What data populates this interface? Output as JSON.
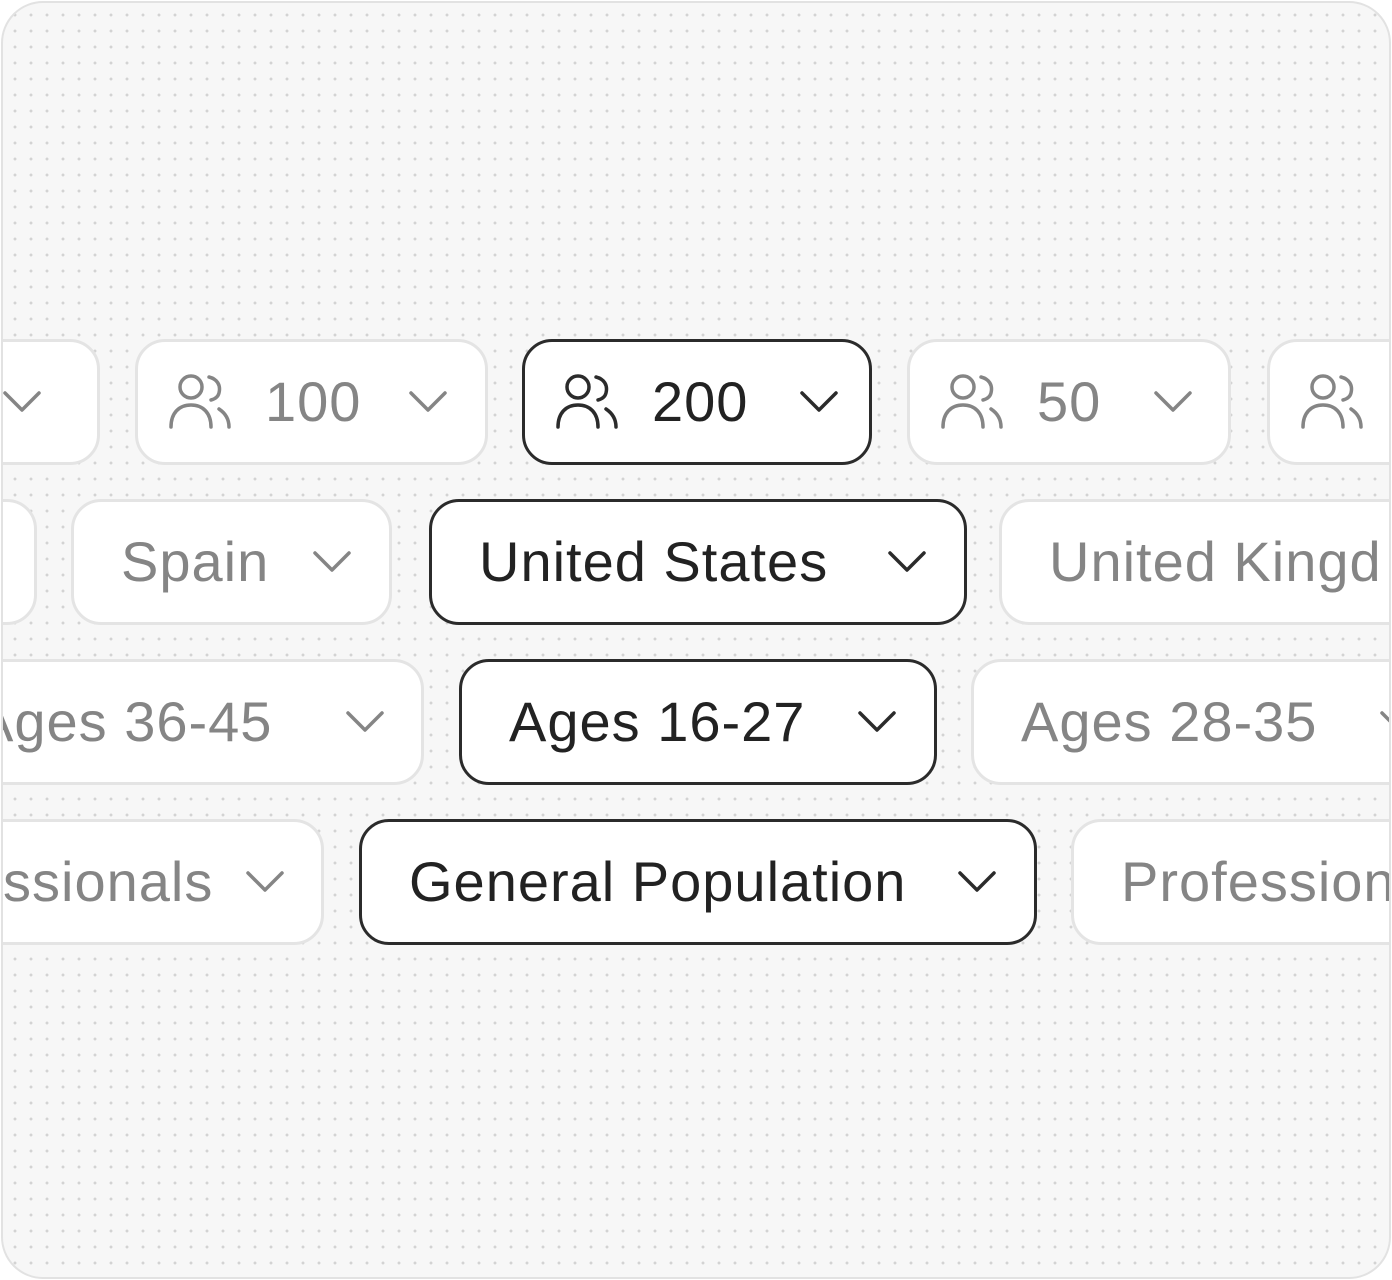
{
  "rows": {
    "sample_size": {
      "options": [
        "100",
        "200",
        "50"
      ],
      "selected": "200"
    },
    "country": {
      "options": [
        "Spain",
        "United States",
        "United Kingd"
      ],
      "selected": "United States"
    },
    "age": {
      "options": [
        "Ages 36-45",
        "Ages 16-27",
        "Ages 28-35"
      ],
      "selected": "Ages 16-27"
    },
    "audience": {
      "options": [
        "ssionals",
        "General Population",
        "Profession"
      ],
      "selected": "General Population"
    }
  },
  "icons": {
    "people": "users-icon",
    "dropdown": "chevron-down-icon"
  },
  "colors": {
    "active_border": "#2b2b2b",
    "inactive_border": "#e4e4e4",
    "active_text": "#222222",
    "inactive_text": "#858585",
    "background": "#f7f7f7"
  }
}
